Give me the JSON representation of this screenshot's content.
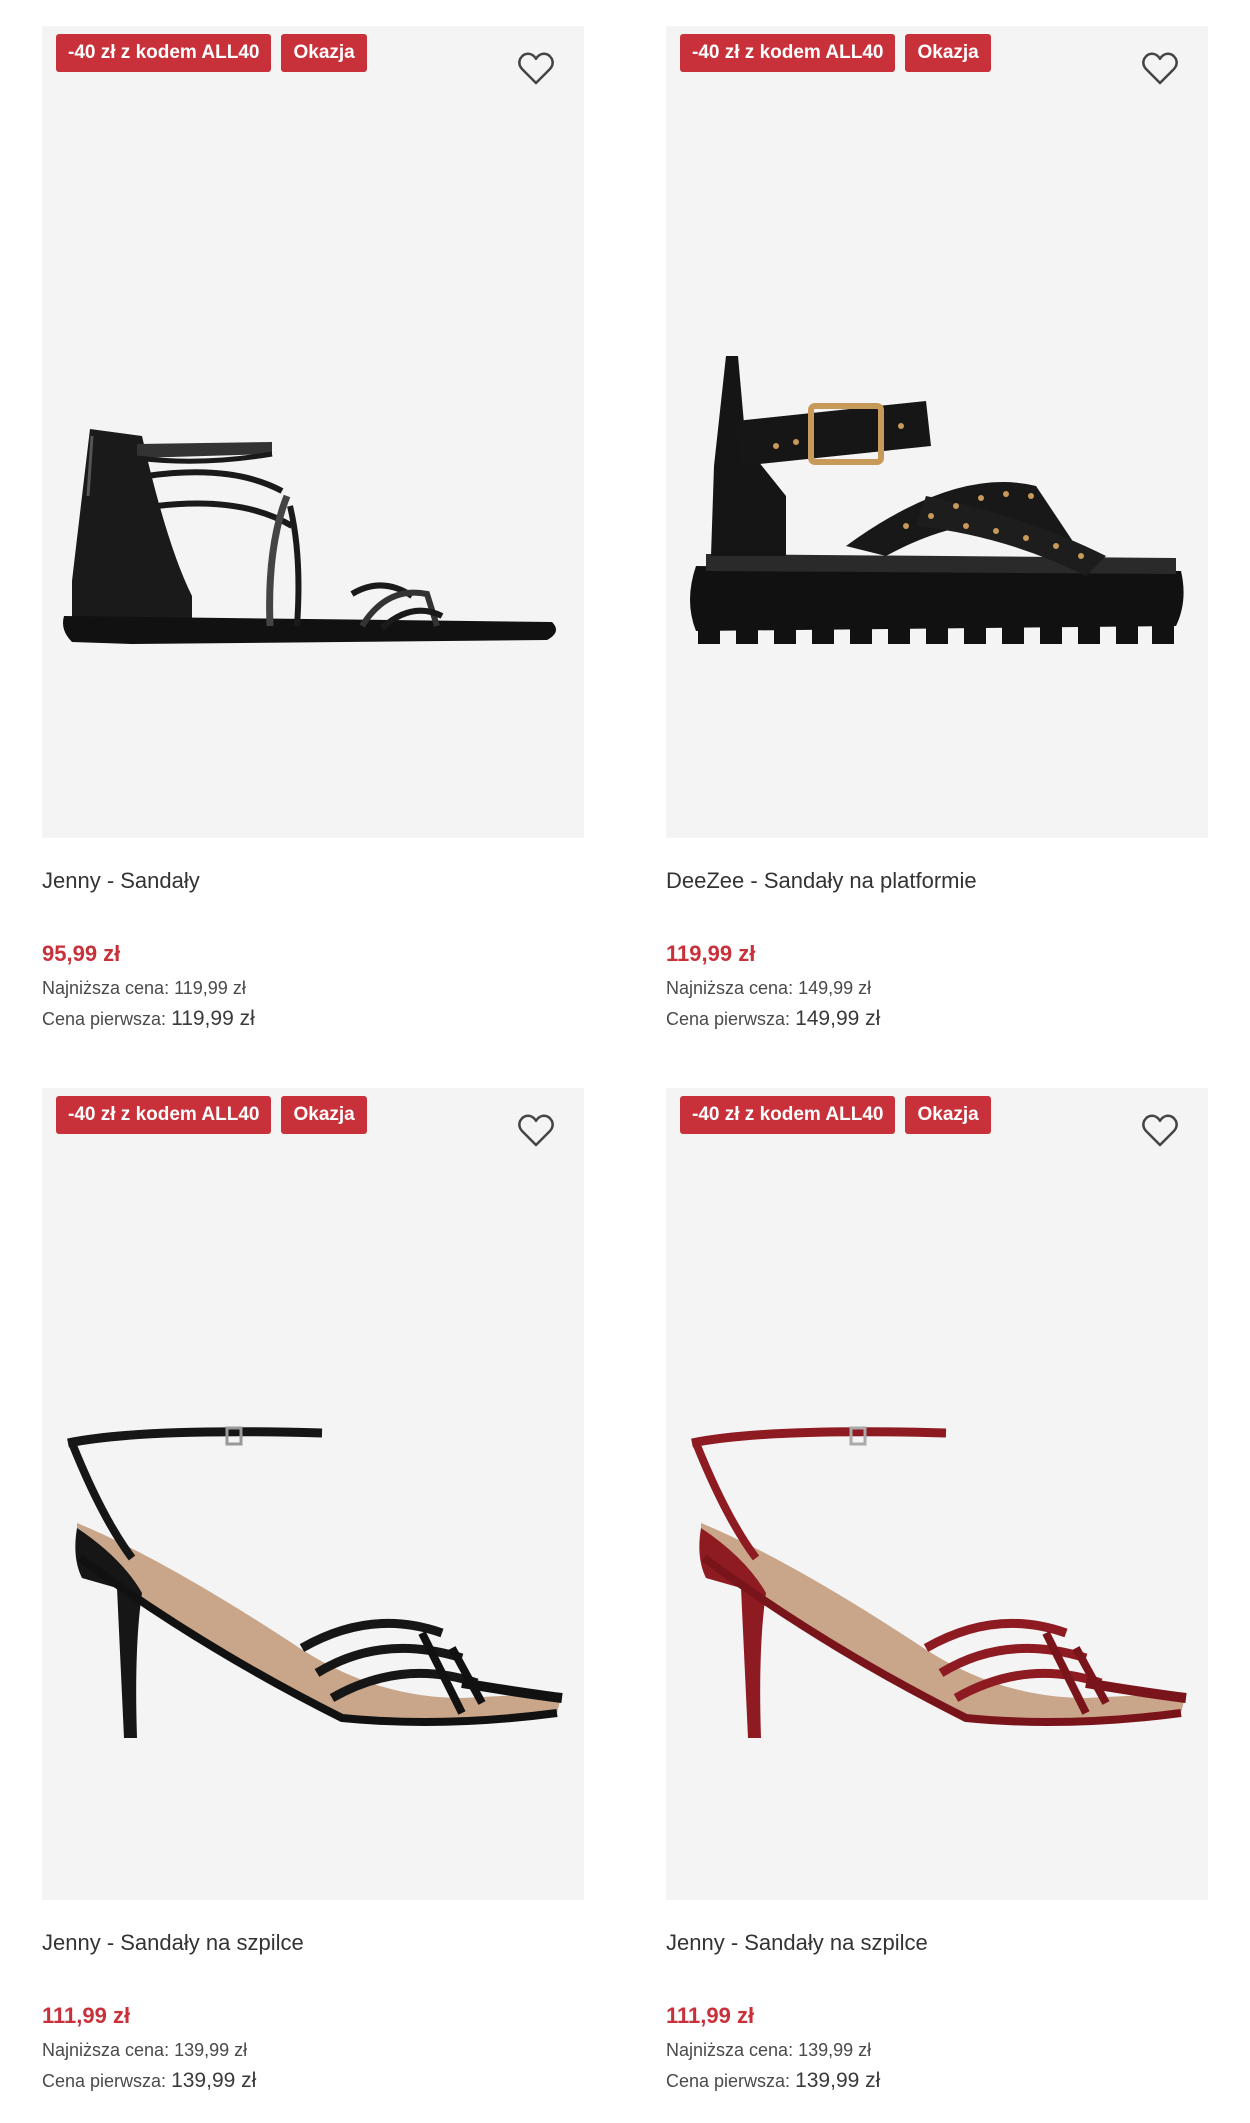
{
  "products": [
    {
      "promo_badge": "-40 zł z kodem ALL40",
      "deal_badge": "Okazja",
      "title": "Jenny - Sandały",
      "price": "95,99 zł",
      "lowest_label": "Najniższa cena:",
      "lowest_value": "119,99 zł",
      "original_label": "Cena pierwsza:",
      "original_value": "119,99 zł",
      "shoe_color": "#1a1a1a"
    },
    {
      "promo_badge": "-40 zł z kodem ALL40",
      "deal_badge": "Okazja",
      "title": "DeeZee - Sandały na platformie",
      "price": "119,99 zł",
      "lowest_label": "Najniższa cena:",
      "lowest_value": "149,99 zł",
      "original_label": "Cena pierwsza:",
      "original_value": "149,99 zł",
      "shoe_color": "#141414"
    },
    {
      "promo_badge": "-40 zł z kodem ALL40",
      "deal_badge": "Okazja",
      "title": "Jenny - Sandały na szpilce",
      "price": "111,99 zł",
      "lowest_label": "Najniższa cena:",
      "lowest_value": "139,99 zł",
      "original_label": "Cena pierwsza:",
      "original_value": "139,99 zł",
      "shoe_color": "#151515"
    },
    {
      "promo_badge": "-40 zł z kodem ALL40",
      "deal_badge": "Okazja",
      "title": "Jenny - Sandały na szpilce",
      "price": "111,99 zł",
      "lowest_label": "Najniższa cena:",
      "lowest_value": "139,99 zł",
      "original_label": "Cena pierwsza:",
      "original_value": "139,99 zł",
      "shoe_color": "#8e1a22"
    }
  ],
  "icons": {
    "favorite": "heart-outline-icon"
  },
  "colors": {
    "badge_bg": "#c8313a",
    "price": "#c8313a",
    "image_bg": "#f4f4f4"
  }
}
